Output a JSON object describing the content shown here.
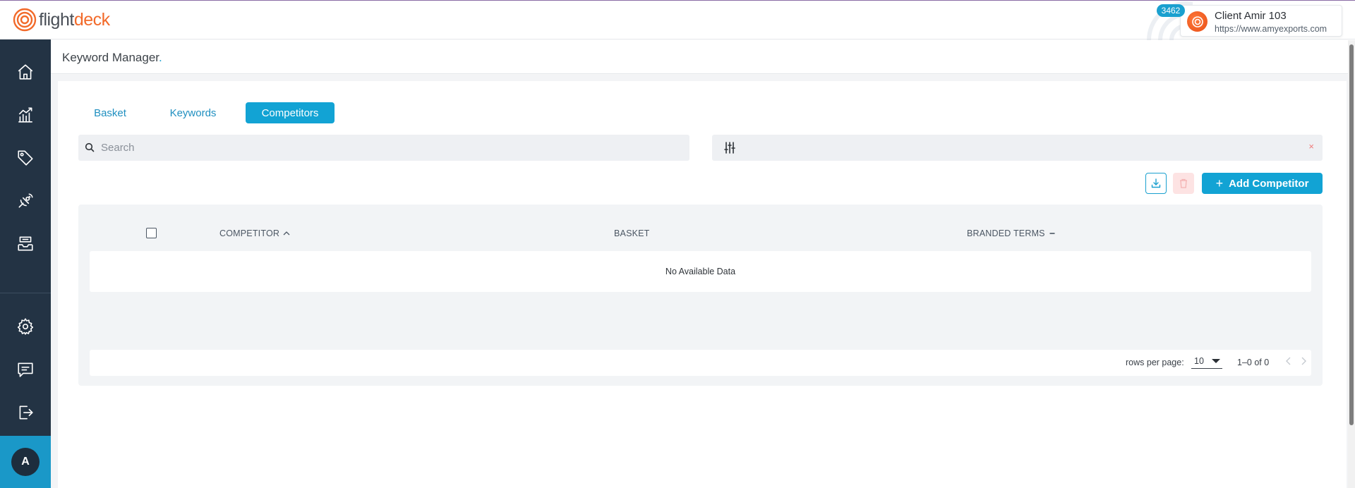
{
  "app": {
    "logo_part1": "flight",
    "logo_part2": "deck"
  },
  "client": {
    "badge": "3462",
    "name": "Client Amir 103",
    "url": "https://www.amyexports.com"
  },
  "sidebar": {
    "items": [
      {
        "icon": "home-icon"
      },
      {
        "icon": "analytics-icon"
      },
      {
        "icon": "tag-icon"
      },
      {
        "icon": "satellite-icon"
      },
      {
        "icon": "inbox-icon"
      }
    ],
    "bottom_items": [
      {
        "icon": "gear-icon"
      },
      {
        "icon": "chat-icon"
      },
      {
        "icon": "logout-icon"
      }
    ],
    "avatar_initial": "A"
  },
  "page": {
    "title": "Keyword Manager",
    "title_dot": "."
  },
  "tabs": [
    {
      "label": "Basket",
      "active": false
    },
    {
      "label": "Keywords",
      "active": false
    },
    {
      "label": "Competitors",
      "active": true
    }
  ],
  "search": {
    "placeholder": "Search",
    "value": ""
  },
  "filter": {
    "close_symbol": "×"
  },
  "actions": {
    "add_label": "Add Competitor",
    "add_symbol": "+"
  },
  "table": {
    "columns": [
      {
        "label": "COMPETITOR",
        "sort": "ascending"
      },
      {
        "label": "BASKET",
        "sort": "none"
      },
      {
        "label": "BRANDED TERMS",
        "sort": "minus"
      }
    ],
    "empty_text": "No Available Data"
  },
  "pagination": {
    "rows_label": "rows per page:",
    "rows_value": "10",
    "range_text": "1–0 of 0"
  },
  "colors": {
    "accent": "#12a3d4",
    "sidebar": "#233344",
    "brand_orange": "#f26a2a"
  }
}
